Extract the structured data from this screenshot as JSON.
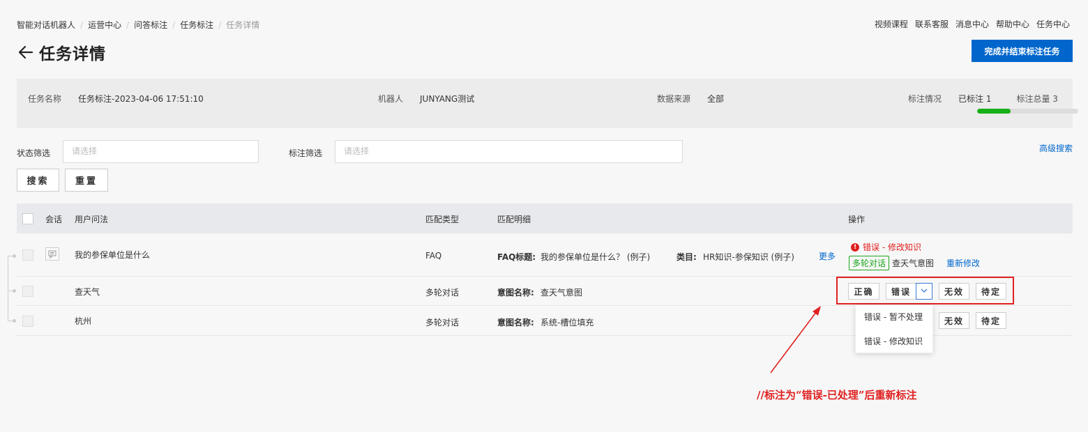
{
  "breadcrumb": [
    "智能对话机器人",
    "运营中心",
    "问答标注",
    "任务标注",
    "任务详情"
  ],
  "topnav": [
    "视频课程",
    "联系客服",
    "消息中心",
    "帮助中心",
    "任务中心"
  ],
  "page_title": "任务详情",
  "finish_button": "完成并结束标注任务",
  "info": {
    "task_name_label": "任务名称",
    "task_name": "任务标注-2023-04-06 17:51:10",
    "robot_label": "机器人",
    "robot": "JUNYANG测试",
    "source_label": "数据来源",
    "source": "全部",
    "status_label": "标注情况",
    "labeled": "已标注 1",
    "total": "标注总量 3",
    "progress_fraction": 0.333
  },
  "filters": {
    "status_label": "状态筛选",
    "status_placeholder": "请选择",
    "mark_label": "标注筛选",
    "mark_placeholder": "请选择",
    "advanced": "高级搜索",
    "search_btn": "搜索",
    "reset_btn": "重置"
  },
  "table": {
    "headers": {
      "session": "会话",
      "question": "用户问法",
      "match_type": "匹配类型",
      "match_detail": "匹配明细",
      "ops": "操作"
    },
    "rows": [
      {
        "question": "我的参保单位是什么",
        "match_type": "FAQ",
        "detail_key1": "FAQ标题:",
        "detail_val1": "我的参保单位是什么？ (例子)",
        "detail_key2": "类目:",
        "detail_val2": "HR知识-参保知识 (例子)",
        "more": "更多",
        "status": "错误 - 修改知识",
        "tag": "多轮对话",
        "intent": "查天气意图",
        "remark": "重新修改"
      },
      {
        "question": "查天气",
        "match_type": "多轮对话",
        "detail_key1": "意图名称:",
        "detail_val1": "查天气意图"
      },
      {
        "question": "杭州",
        "match_type": "多轮对话",
        "detail_key1": "意图名称:",
        "detail_val1": "系统-槽位填充"
      }
    ]
  },
  "ops": {
    "correct": "正确",
    "wrong": "错误",
    "invalid": "无效",
    "pending": "待定"
  },
  "dropdown": [
    "错误 - 暂不处理",
    "错误 - 修改知识"
  ],
  "annotation": "//标注为“错误-已处理”后重新标注",
  "colors": {
    "primary": "#0066cc",
    "error": "#e02020",
    "success": "#19a619"
  }
}
